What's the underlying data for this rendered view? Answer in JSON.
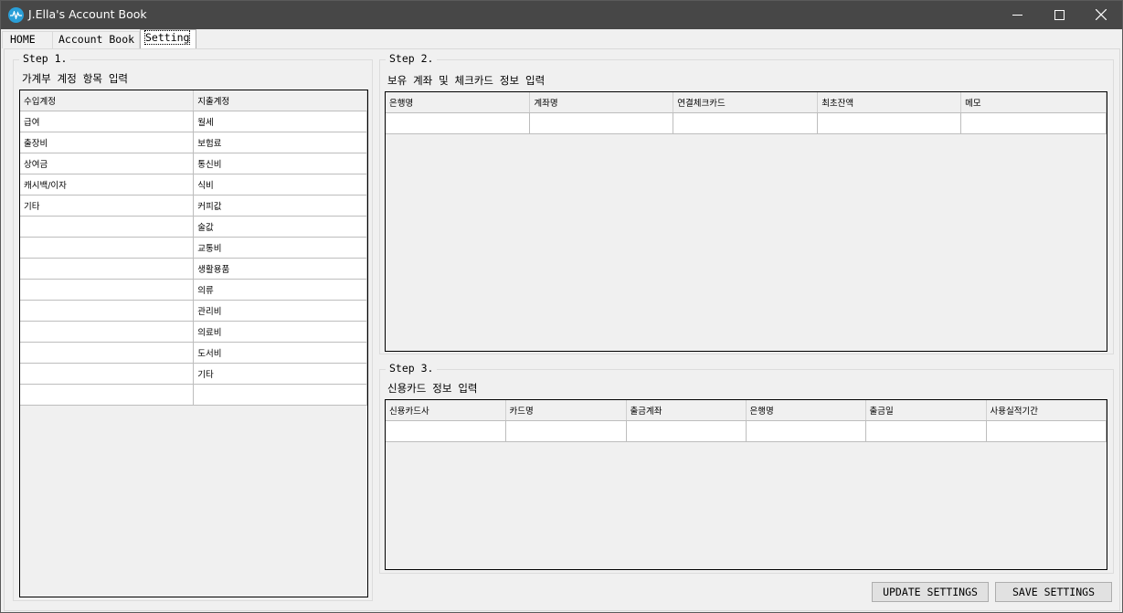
{
  "window": {
    "title": "J.Ella's Account Book",
    "accent_color": "#2a9fd8"
  },
  "tabs": [
    {
      "label": "HOME"
    },
    {
      "label": "Account Book"
    },
    {
      "label": "Setting",
      "selected": true
    }
  ],
  "step1": {
    "title": "Step 1.",
    "description": "가계부 계정 항목 입력",
    "columns": [
      "수입계정",
      "지출계정"
    ],
    "rows": [
      [
        "급여",
        "월세"
      ],
      [
        "출장비",
        "보험료"
      ],
      [
        "상여금",
        "통신비"
      ],
      [
        "캐시백/이자",
        "식비"
      ],
      [
        "기타",
        "커피값"
      ],
      [
        "",
        "술값"
      ],
      [
        "",
        "교통비"
      ],
      [
        "",
        "생활용품"
      ],
      [
        "",
        "의류"
      ],
      [
        "",
        "관리비"
      ],
      [
        "",
        "의료비"
      ],
      [
        "",
        "도서비"
      ],
      [
        "",
        "기타"
      ],
      [
        "",
        ""
      ]
    ]
  },
  "step2": {
    "title": "Step 2.",
    "description": "보유 계좌 및 체크카드 정보 입력",
    "columns": [
      "은행명",
      "계좌명",
      "연결체크카드",
      "최초잔액",
      "메모"
    ],
    "rows": [
      [
        "",
        "",
        "",
        "",
        ""
      ]
    ]
  },
  "step3": {
    "title": "Step 3.",
    "description": "신용카드 정보 입력",
    "columns": [
      "신용카드사",
      "카드명",
      "출금계좌",
      "은행명",
      "출금일",
      "사용실적기간"
    ],
    "rows": [
      [
        "",
        "",
        "",
        "",
        "",
        ""
      ]
    ]
  },
  "buttons": {
    "update": "UPDATE SETTINGS",
    "save": "SAVE SETTINGS"
  }
}
